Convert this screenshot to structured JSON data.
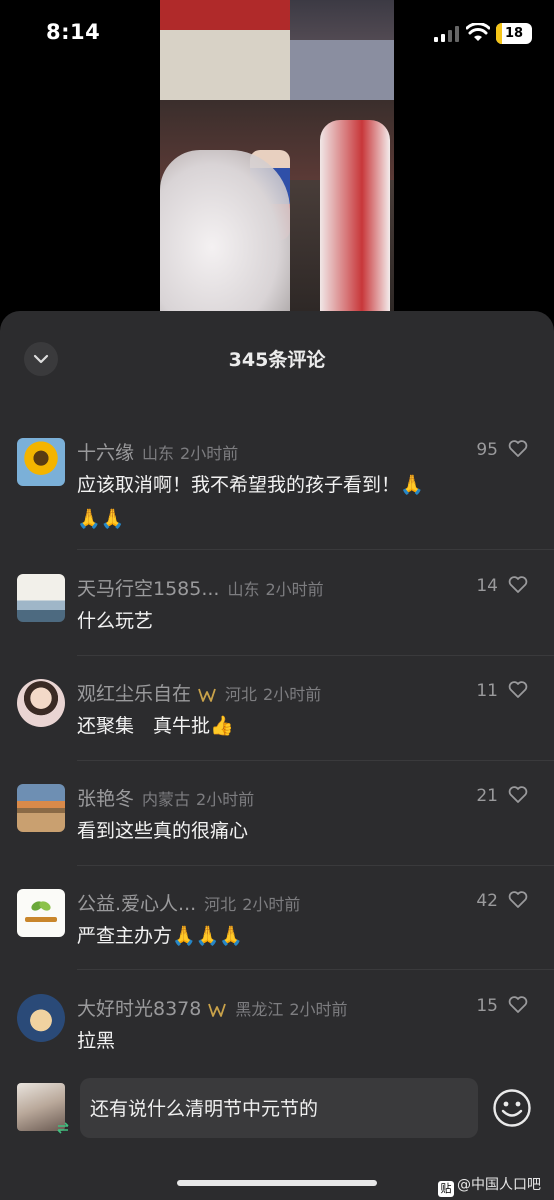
{
  "status_bar": {
    "time": "8:14",
    "battery": "18"
  },
  "sheet": {
    "title": "345条评论"
  },
  "comments": [
    {
      "name": "十六缘",
      "location": "山东",
      "time": "2小时前",
      "text": "应该取消啊！我不希望我的孩子看到！🙏🙏🙏",
      "likes": "95",
      "avatar": "sunflower",
      "vip": false
    },
    {
      "name": "天马行空1585...",
      "location": "山东",
      "time": "2小时前",
      "text": "什么玩艺",
      "likes": "14",
      "avatar": "landscape-calligraphy",
      "vip": false
    },
    {
      "name": "观红尘乐自在",
      "location": "河北",
      "time": "2小时前",
      "text": "还聚集　真牛批👍",
      "likes": "11",
      "avatar": "girl-portrait",
      "vip": true
    },
    {
      "name": "张艳冬",
      "location": "内蒙古",
      "time": "2小时前",
      "text": "看到这些真的很痛心",
      "likes": "21",
      "avatar": "road-sunset",
      "vip": false
    },
    {
      "name": "公益.爱心人...",
      "location": "河北",
      "time": "2小时前",
      "text": "严查主办方🙏🙏🙏",
      "likes": "42",
      "avatar": "tea-logo",
      "vip": false
    },
    {
      "name": "大好时光8378",
      "location": "黑龙江",
      "time": "2小时前",
      "text": "拉黑",
      "likes": "15",
      "avatar": "cartoon-family",
      "vip": true
    }
  ],
  "input": {
    "value": "还有说什么清明节中元节的"
  },
  "watermark": {
    "icon_text": "贴",
    "text": "@中国人口吧"
  },
  "colors": {
    "sheet_bg": "#2c2c2e",
    "text": "#f2f2f2",
    "meta": "#7d7d80",
    "vip": "#c9a24a"
  }
}
